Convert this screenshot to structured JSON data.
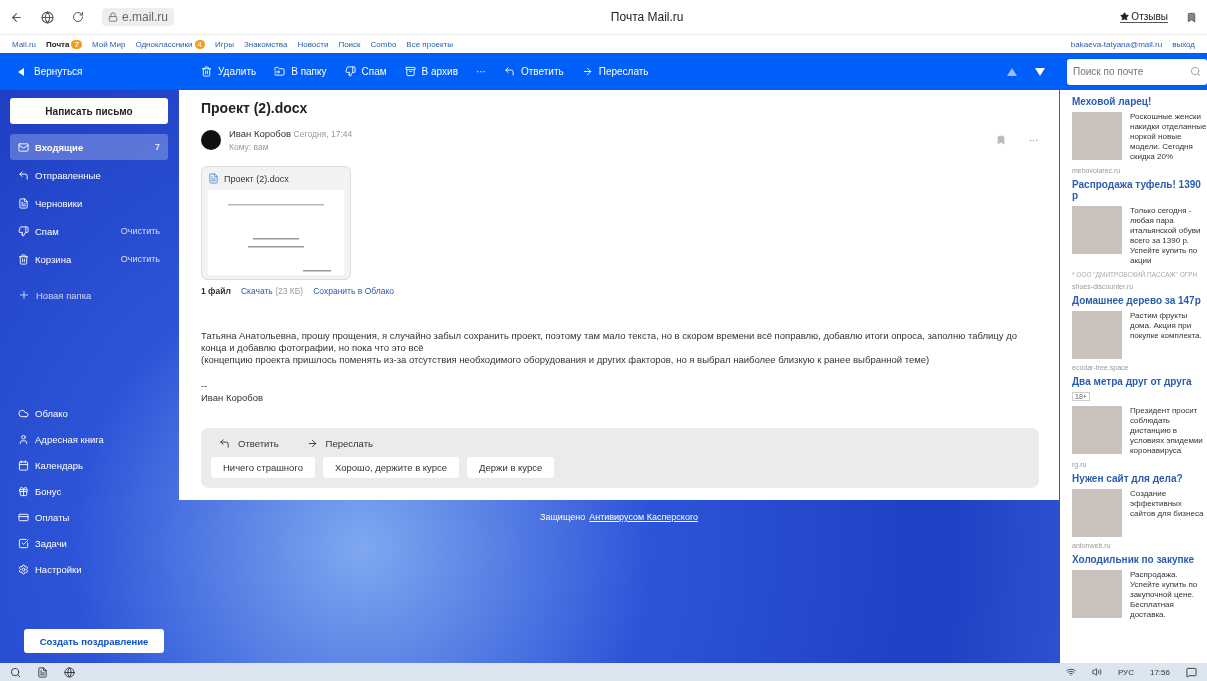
{
  "browser": {
    "address": "e.mail.ru",
    "title": "Почта Mail.ru",
    "reviews": "Отзывы"
  },
  "portal": {
    "links": [
      {
        "label": "Mail.ru",
        "bold": false
      },
      {
        "label": "Почта",
        "badge": "7",
        "bold": true
      },
      {
        "label": "Мой Мир",
        "bold": false
      },
      {
        "label": "Одноклассники",
        "badge": "4",
        "bold": false
      },
      {
        "label": "Игры",
        "bold": false
      },
      {
        "label": "Знакомства",
        "bold": false
      },
      {
        "label": "Новости",
        "bold": false
      },
      {
        "label": "Поиск",
        "bold": false
      },
      {
        "label": "Combo",
        "bold": false
      },
      {
        "label": "Все проекты",
        "bold": false
      }
    ],
    "user": "bakaeva-tatyana@mail.ru",
    "logout": "выход"
  },
  "toolbar": {
    "back": "Вернуться",
    "actions": [
      {
        "kind": "delete",
        "label": "Удалить"
      },
      {
        "kind": "folder",
        "label": "В папку"
      },
      {
        "kind": "spam",
        "label": "Спам"
      },
      {
        "kind": "archive",
        "label": "В архив"
      },
      {
        "kind": "more",
        "label": "···"
      },
      {
        "kind": "reply",
        "label": "Ответить"
      },
      {
        "kind": "forward",
        "label": "Переслать"
      }
    ],
    "search": {
      "placeholder": "Поиск по почте"
    }
  },
  "sidebar": {
    "compose": "Написать письмо",
    "folders": [
      {
        "kind": "inbox",
        "label": "Входящие",
        "count": "7",
        "selected": true
      },
      {
        "kind": "sent",
        "label": "Отправленные",
        "selected": false
      },
      {
        "kind": "drafts",
        "label": "Черновики",
        "selected": false
      },
      {
        "kind": "spam",
        "label": "Спам",
        "action": "Очистить",
        "selected": false
      },
      {
        "kind": "trash",
        "label": "Корзина",
        "action": "Очистить",
        "selected": false
      }
    ],
    "new_folder": "Новая папка",
    "services": [
      {
        "kind": "cloud",
        "label": "Облако"
      },
      {
        "kind": "contacts",
        "label": "Адресная книга"
      },
      {
        "kind": "calendar",
        "label": "Календарь"
      },
      {
        "kind": "bonus",
        "label": "Бонус"
      },
      {
        "kind": "payments",
        "label": "Оплаты"
      },
      {
        "kind": "tasks",
        "label": "Задачи"
      },
      {
        "kind": "settings",
        "label": "Настройки"
      }
    ],
    "greeting": "Создать поздравление"
  },
  "message": {
    "subject": "Проект (2).docx",
    "sender": "Иван Коробов",
    "date": "Сегодня, 17:44",
    "to": "Кому: вам",
    "attachment": {
      "name": "Проект (2).docx",
      "count": "1 файл",
      "download": "Скачать",
      "size": "(23 КБ)",
      "save": "Сохранить в Облако"
    },
    "body": [
      "Татьяна Анатольевна, прошу прощения, я случайно забыл сохранить проект, поэтому там мало текста, но в скором времени всё поправлю, добавлю итоги опроса, заполню таблицу до конца и добавлю фотографии, но пока что это всё",
      "(концепцию проекта пришлось поменять из-за отсутствия необходимого оборудования и других факторов, но я выбрал наиболее близкую к ранее выбранной теме)"
    ],
    "signature_sep": "--",
    "signature": "Иван Коробов",
    "reply": "Ответить",
    "forward": "Переслать",
    "quick_replies": [
      "Ничего страшного",
      "Хорошо, держите в курсе",
      "Держи в курсе"
    ]
  },
  "footer": {
    "text": "Защищено",
    "link": "Антивирусом Касперского"
  },
  "ads": [
    {
      "title": "Меховой ларец!",
      "text": "Роскошные женски накидки отделанные норкой новые модели. Сегодня скидка 20%",
      "domain": "mehovolarec.ru"
    },
    {
      "title": "Распродажа туфель! 1390 р",
      "text": "Только сегодня - любая пара итальянской обуви всего за 1390 р. Успейте купить по акции",
      "note": "* ООО \"ДМИТРОВСКИЙ ПАССАЖ\" ОГРН",
      "domain": "shoes-discounter.ru"
    },
    {
      "title": "Домашнее дерево за 147р",
      "text": "Растим фрукты дома. Акция при покупке комплекта.",
      "domain": "ecodar-tree.space"
    },
    {
      "title": "Два метра друг от друга",
      "text": "Президент просит соблюдать дистанцию в условиях эпидемии коронавируса",
      "age": "18+",
      "domain": "rg.ru"
    },
    {
      "title": "Нужен сайт для дела?",
      "text": "Создание эффективных сайтов для бизнеса",
      "domain": "antonweb.ru"
    },
    {
      "title": "Холодильник по закупке",
      "text": "Распродажа. Успейте купить по закупочной цене. Бесплатная доставка."
    }
  ],
  "taskbar": {
    "lang": "РУС",
    "time": "17:56"
  }
}
